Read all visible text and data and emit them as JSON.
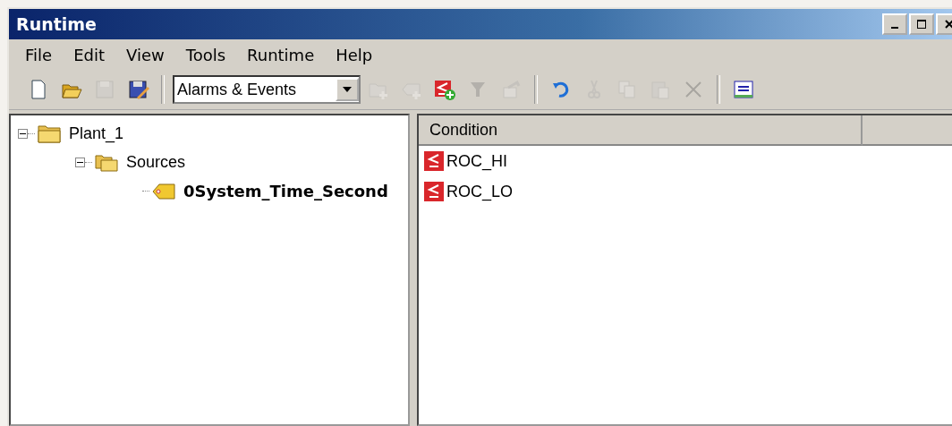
{
  "window": {
    "title": "Runtime"
  },
  "menu": [
    {
      "label": "File"
    },
    {
      "label": "Edit"
    },
    {
      "label": "View"
    },
    {
      "label": "Tools"
    },
    {
      "label": "Runtime"
    },
    {
      "label": "Help"
    }
  ],
  "toolbar": [
    {
      "kind": "new",
      "disabled": false
    },
    {
      "kind": "open",
      "disabled": false
    },
    {
      "kind": "save",
      "disabled": true
    },
    {
      "kind": "save-edit",
      "disabled": false
    },
    {
      "kind": "separator"
    },
    {
      "kind": "dropdown",
      "value": "Alarms & Events"
    },
    {
      "kind": "add-folder",
      "disabled": true
    },
    {
      "kind": "add-tag",
      "disabled": true
    },
    {
      "kind": "add-condition",
      "disabled": false
    },
    {
      "kind": "filter",
      "disabled": true
    },
    {
      "kind": "export",
      "disabled": true
    },
    {
      "kind": "separator"
    },
    {
      "kind": "undo",
      "disabled": false
    },
    {
      "kind": "cut",
      "disabled": true
    },
    {
      "kind": "copy",
      "disabled": true
    },
    {
      "kind": "paste",
      "disabled": true
    },
    {
      "kind": "delete",
      "disabled": true
    },
    {
      "kind": "separator"
    },
    {
      "kind": "quick-client",
      "disabled": false
    }
  ],
  "tree": [
    {
      "label": "Plant_1",
      "kind": "folder",
      "expanded": true,
      "selected": false,
      "children": [
        {
          "label": "Sources",
          "kind": "sources",
          "expanded": true,
          "selected": false,
          "children": [
            {
              "label": "0System_Time_Second",
              "kind": "tag",
              "selected": true
            }
          ]
        }
      ]
    }
  ],
  "table": {
    "columns": [
      "Condition"
    ],
    "rows": [
      {
        "condition": "ROC_HI"
      },
      {
        "condition": "ROC_LO"
      }
    ]
  }
}
